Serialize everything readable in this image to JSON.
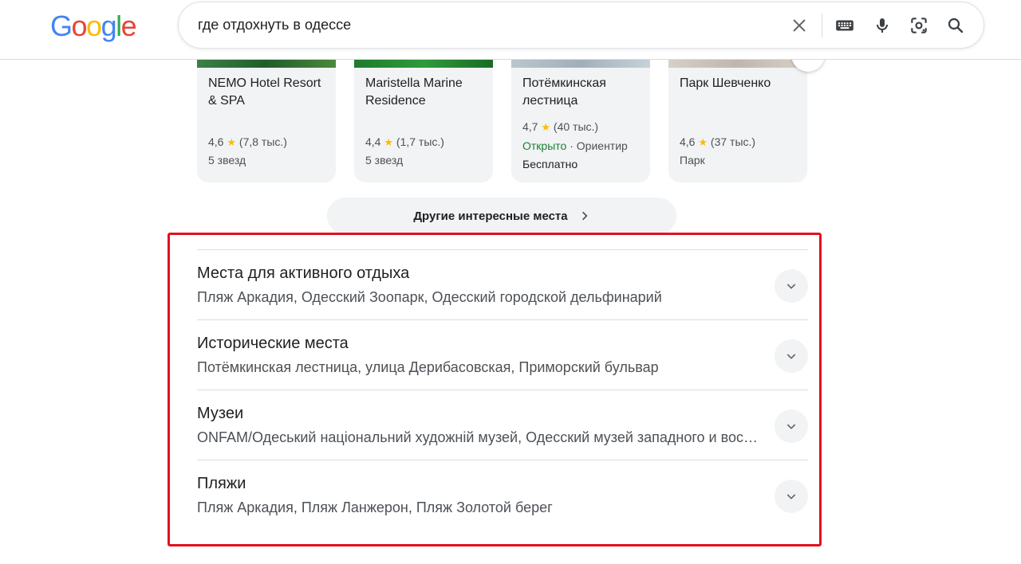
{
  "logo": {
    "letters": [
      "G",
      "o",
      "o",
      "g",
      "l",
      "e"
    ],
    "colors": [
      "#4285F4",
      "#EA4335",
      "#FBBC05",
      "#4285F4",
      "#34A853",
      "#EA4335"
    ]
  },
  "search": {
    "query": "где отдохнуть в одессе",
    "icons": [
      "clear-icon",
      "keyboard-icon",
      "microphone-icon",
      "lens-icon",
      "search-icon"
    ]
  },
  "cards": [
    {
      "title": "NEMO Hotel Resort & SPA",
      "rating": "4,6",
      "reviews": "(7,8 тыс.)",
      "type": "5 звезд",
      "image_color": "#2f6d3a"
    },
    {
      "title": "Maristella Marine Residence",
      "rating": "4,4",
      "reviews": "(1,7 тыс.)",
      "type": "5 звезд",
      "image_color": "#1e7a2c"
    },
    {
      "title": "Потёмкинская лестница",
      "rating": "4,7",
      "reviews": "(40 тыс.)",
      "status": "Открыто",
      "status_sep": "·",
      "category": "Ориентир",
      "price": "Бесплатно",
      "image_color": "#a8b6bf"
    },
    {
      "title": "Парк Шевченко",
      "rating": "4,6",
      "reviews": "(37 тыс.)",
      "type": "Парк",
      "image_color": "#cdc6bd"
    }
  ],
  "more_places": {
    "label": "Другие интересные места"
  },
  "accordion": [
    {
      "title": "Места для активного отдыха",
      "subtitle": "Пляж Аркадия, Одесский Зоопарк, Одесский городской дельфинарий"
    },
    {
      "title": "Исторические места",
      "subtitle": "Потёмкинская лестница, улица Дерибасовская, Приморский бульвар"
    },
    {
      "title": "Музеи",
      "subtitle": "ONFAM/Одеський національний художній музей, Одесский музей западного и восточного искусства"
    },
    {
      "title": "Пляжи",
      "subtitle": "Пляж Аркадия, Пляж Ланжерон, Пляж Золотой берег"
    }
  ],
  "colors": {
    "highlight": "#e2111d",
    "star": "#fbbc04",
    "open": "#188038",
    "text_secondary": "#4d5156"
  }
}
